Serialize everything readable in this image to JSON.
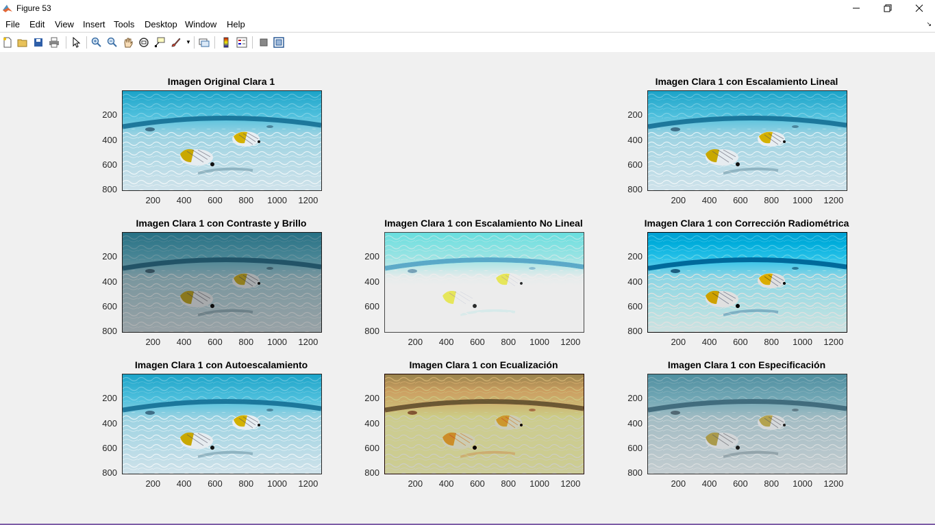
{
  "window": {
    "title": "Figure 53"
  },
  "menu": [
    "File",
    "Edit",
    "View",
    "Insert",
    "Tools",
    "Desktop",
    "Window",
    "Help"
  ],
  "toolbar": [
    "new-figure-icon",
    "open-file-icon",
    "save-icon",
    "print-icon",
    "edit-plot-icon",
    "zoom-in-icon",
    "zoom-out-icon",
    "pan-icon",
    "rotate-3d-icon",
    "data-cursor-icon",
    "brush-icon",
    "link-plot-icon",
    "colorbar-icon",
    "legend-icon",
    "hide-plot-tools-icon",
    "show-plot-tools-icon"
  ],
  "axis": {
    "yticks": [
      "200",
      "400",
      "600",
      "800"
    ],
    "xticks": [
      "200",
      "400",
      "600",
      "800",
      "1000",
      "1200"
    ]
  },
  "subplots": [
    {
      "title": "Imagen Original Clara 1",
      "variant": "original"
    },
    {
      "title": "Imagen Clara 1 con Escalamiento Lineal",
      "variant": "original"
    },
    {
      "title": "Imagen Clara 1 con Contraste y Brillo",
      "variant": "dark"
    },
    {
      "title": "Imagen Clara 1 con Escalamiento No Lineal",
      "variant": "bright"
    },
    {
      "title": "Imagen Clara 1 con Corrección Radiométrica",
      "variant": "contrast"
    },
    {
      "title": "Imagen Clara 1 con Autoescalamiento",
      "variant": "original"
    },
    {
      "title": "Imagen Clara 1 con Ecualización",
      "variant": "equalized"
    },
    {
      "title": "Imagen Clara 1 con Especificación",
      "variant": "muted"
    }
  ]
}
